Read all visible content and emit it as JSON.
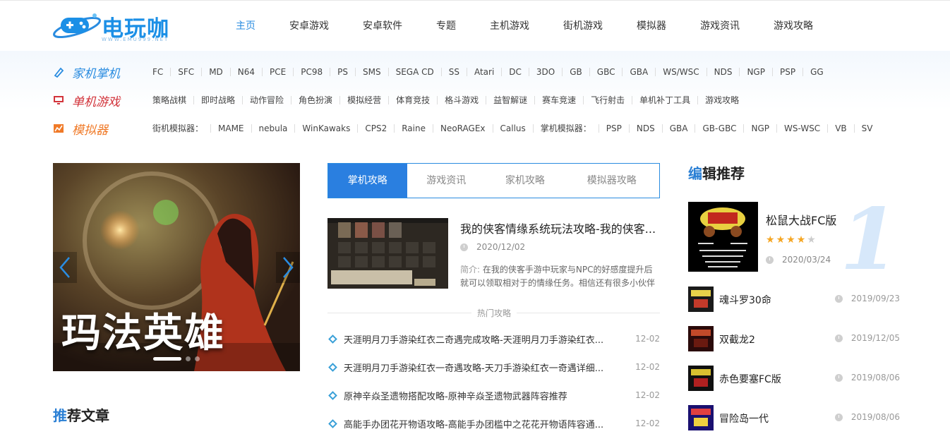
{
  "logo": {
    "text": "电玩咖",
    "sub": "WWW.EMU999.NET"
  },
  "nav": [
    "主页",
    "安卓游戏",
    "安卓软件",
    "专题",
    "主机游戏",
    "街机游戏",
    "模拟器",
    "游戏资讯",
    "游戏攻略"
  ],
  "categories": [
    {
      "title": "家机掌机",
      "color": "#2a8ce0",
      "icon": "pencil-icon",
      "links": [
        "FC",
        "SFC",
        "MD",
        "N64",
        "PCE",
        "PC98",
        "PS",
        "SMS",
        "SEGA CD",
        "SS",
        "Atari",
        "DC",
        "3DO",
        "GB",
        "GBC",
        "GBA",
        "WS/WSC",
        "NDS",
        "NGP",
        "PSP",
        "GG"
      ]
    },
    {
      "title": "单机游戏",
      "color": "#d2343b",
      "icon": "monitor-icon",
      "links": [
        "策略战棋",
        "即时战略",
        "动作冒险",
        "角色扮演",
        "模拟经营",
        "体育竞技",
        "格斗游戏",
        "益智解谜",
        "赛车竞速",
        "飞行射击",
        "单机补丁工具",
        "游戏攻略"
      ]
    },
    {
      "title": "模拟器",
      "color": "#f07a28",
      "icon": "chart-icon",
      "links": [
        "街机模拟器：",
        "MAME",
        "nebula",
        "WinKawaks",
        "CPS2",
        "Raine",
        "NeoRAGEx",
        "Callus",
        "掌机模拟器：",
        "PSP",
        "NDS",
        "GBA",
        "GB-GBC",
        "NGP",
        "WS-WSC",
        "VB",
        "SV"
      ]
    }
  ],
  "slider": {
    "title": "玛法英雄"
  },
  "sections": {
    "recommend_pre": "推",
    "recommend_rest": "荐文章",
    "editor_pre": "编",
    "editor_rest": "辑推荐",
    "hot_label": "热门攻略"
  },
  "tabs": [
    "掌机攻略",
    "游戏资讯",
    "家机攻略",
    "模拟器攻略"
  ],
  "feature": {
    "title": "我的侠客情缘系统玩法攻略-我的侠客...",
    "date": "2020/12/02",
    "summary_label": "简介:",
    "summary": "在我的侠客手游中玩家与NPC的好感度提升后就可以领取相对于的情缘任务。相信还有很多小伙伴"
  },
  "articles": [
    {
      "title": "天涯明月刀手游染红衣二奇遇完成攻略-天涯明月刀手游染红衣...",
      "date": "12-02"
    },
    {
      "title": "天涯明月刀手游染红衣一奇遇攻略-天刀手游染红衣一奇遇详细...",
      "date": "12-02"
    },
    {
      "title": "原神辛焱圣遗物搭配攻略-原神辛焱圣遗物武器阵容推荐",
      "date": "12-02"
    },
    {
      "title": "高能手办团花开物语攻略-高能手办团槛中之花花开物语阵容通...",
      "date": "12-02"
    }
  ],
  "editor_top": {
    "name": "松鼠大战FC版",
    "date": "2020/03/24",
    "rank": "1",
    "rating": 4,
    "rating_max": 5
  },
  "editor_list": [
    {
      "name": "魂斗罗30命",
      "date": "2019/09/23"
    },
    {
      "name": "双截龙2",
      "date": "2019/12/05"
    },
    {
      "name": "赤色要塞FC版",
      "date": "2019/08/06"
    },
    {
      "name": "冒险岛一代",
      "date": "2019/08/06"
    }
  ],
  "colors": {
    "accent": "#2a8ce0",
    "tab_active": "#2a7fe0",
    "star": "#f5a623"
  }
}
